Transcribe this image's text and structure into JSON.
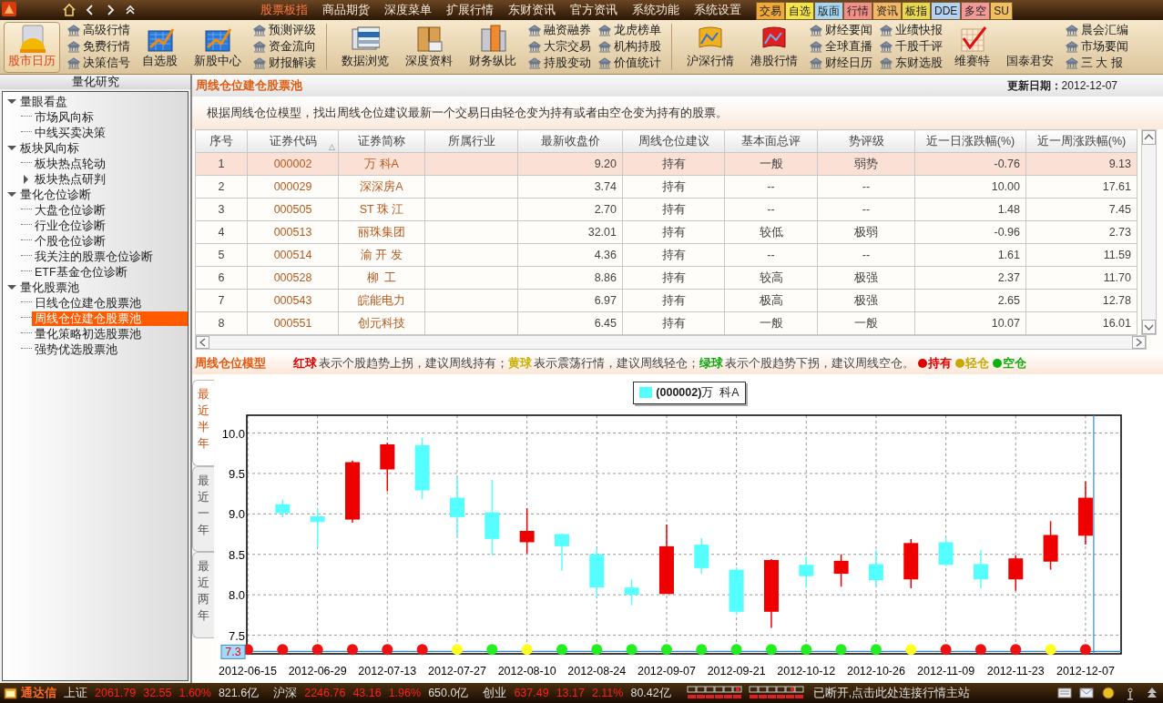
{
  "top_bar": {
    "menu": [
      {
        "label": "股票板指",
        "selected": true
      },
      {
        "label": "商品期货",
        "selected": false
      },
      {
        "label": "深度菜单",
        "selected": false
      },
      {
        "label": "扩展行情",
        "selected": false
      },
      {
        "label": "东财资讯",
        "selected": false
      },
      {
        "label": "官方资讯",
        "selected": false
      },
      {
        "label": "系统功能",
        "selected": false
      },
      {
        "label": "系统设置",
        "selected": false
      }
    ],
    "quick_tabs": [
      {
        "label": "交易",
        "color": "#f0a838"
      },
      {
        "label": "自选",
        "color": "#f2e44a"
      },
      {
        "label": "版面",
        "color": "#a6d6f2"
      },
      {
        "label": "行情",
        "color": "#f29088"
      },
      {
        "label": "资讯",
        "color": "#f2b866"
      },
      {
        "label": "板指",
        "color": "#e8d850"
      },
      {
        "label": "DDE",
        "color": "#b4d2f2"
      },
      {
        "label": "多空",
        "color": "#f29898"
      },
      {
        "label": "SU",
        "color": "#f0c060"
      }
    ]
  },
  "toolbar": [
    {
      "kind": "button",
      "label": "股市日历",
      "selected": true
    },
    {
      "kind": "links",
      "items": [
        "高级行情",
        "免费行情",
        "决策信号"
      ]
    },
    {
      "kind": "button",
      "label": "自选股",
      "selected": false
    },
    {
      "kind": "button",
      "label": "新股中心",
      "selected": false
    },
    {
      "kind": "links",
      "items": [
        "预测评级",
        "资金流向",
        "财报解读"
      ]
    },
    {
      "kind": "separator"
    },
    {
      "kind": "button",
      "label": "数据浏览",
      "selected": false
    },
    {
      "kind": "button",
      "label": "深度资料",
      "selected": false
    },
    {
      "kind": "button",
      "label": "财务纵比",
      "selected": false
    },
    {
      "kind": "links",
      "items": [
        "融资融券",
        "大宗交易",
        "持股变动"
      ]
    },
    {
      "kind": "links",
      "items": [
        "龙虎榜单",
        "机构持股",
        "价值统计"
      ]
    },
    {
      "kind": "separator"
    },
    {
      "kind": "button",
      "label": "沪深行情",
      "selected": false
    },
    {
      "kind": "button",
      "label": "港股行情",
      "selected": false
    },
    {
      "kind": "links",
      "items": [
        "财经要闻",
        "全球直播",
        "财经日历"
      ]
    },
    {
      "kind": "links",
      "items": [
        "业绩快报",
        "千股千评",
        "东财选股"
      ]
    },
    {
      "kind": "button",
      "label": "维赛特",
      "selected": false
    },
    {
      "kind": "button",
      "label": "国泰君安",
      "selected": false
    },
    {
      "kind": "links",
      "items": [
        "晨会汇编",
        "市场要闻",
        "三 大 报"
      ]
    }
  ],
  "sidebar": {
    "title": "量化研究",
    "tree": [
      {
        "label": "量眼看盘",
        "expanded": true,
        "selected": false,
        "children": [
          {
            "label": "市场风向标",
            "selected": false
          },
          {
            "label": "中线买卖决策",
            "selected": false
          }
        ]
      },
      {
        "label": "板块风向标",
        "expanded": true,
        "selected": false,
        "children": [
          {
            "label": "板块热点轮动",
            "selected": false
          },
          {
            "label": "板块热点研判",
            "expanded": false,
            "selected": false
          }
        ]
      },
      {
        "label": "量化仓位诊断",
        "expanded": true,
        "selected": false,
        "children": [
          {
            "label": "大盘仓位诊断",
            "selected": false
          },
          {
            "label": "行业仓位诊断",
            "selected": false
          },
          {
            "label": "个股仓位诊断",
            "selected": false
          },
          {
            "label": "我关注的股票仓位诊断",
            "selected": false
          },
          {
            "label": "ETF基金仓位诊断",
            "selected": false
          }
        ]
      },
      {
        "label": "量化股票池",
        "expanded": true,
        "selected": false,
        "children": [
          {
            "label": "日线仓位建仓股票池",
            "selected": false
          },
          {
            "label": "周线仓位建仓股票池",
            "selected": true
          },
          {
            "label": "量化策略初选股票池",
            "selected": false
          },
          {
            "label": "强势优选股票池",
            "selected": false
          }
        ]
      }
    ]
  },
  "page": {
    "title": "周线仓位建仓股票池",
    "update_label": "更新日期：",
    "update_date": "2012-12-07",
    "description": "根据周线仓位模型，找出周线仓位建议最新一个交易日由轻仓变为持有或者由空仓变为持有的股票。"
  },
  "table": {
    "columns": [
      {
        "label": "序号"
      },
      {
        "label": "证券代码",
        "sort_mark": "△"
      },
      {
        "label": "证券简称"
      },
      {
        "label": "所属行业"
      },
      {
        "label": "最新收盘价"
      },
      {
        "label": "周线仓位建议"
      },
      {
        "label": "基本面总评"
      },
      {
        "label": "势评级"
      },
      {
        "label": "近一日涨跌幅(%)"
      },
      {
        "label": "近一周涨跌幅(%)"
      }
    ],
    "rows": [
      {
        "selected": true,
        "cells": [
          "1",
          "000002",
          "万 科A",
          null,
          "9.20",
          "持有",
          "一般",
          "弱势",
          "-0.76",
          "9.13"
        ]
      },
      {
        "selected": false,
        "cells": [
          "2",
          "000029",
          "深深房A",
          null,
          "3.74",
          "持有",
          "--",
          "--",
          "10.00",
          "17.61"
        ]
      },
      {
        "selected": false,
        "cells": [
          "3",
          "000505",
          "ST 珠 江",
          null,
          "2.70",
          "持有",
          "--",
          "--",
          "1.48",
          "7.45"
        ]
      },
      {
        "selected": false,
        "cells": [
          "4",
          "000513",
          "丽珠集团",
          null,
          "32.01",
          "持有",
          "较低",
          "极弱",
          "-0.96",
          "2.73"
        ]
      },
      {
        "selected": false,
        "cells": [
          "5",
          "000514",
          "渝 开 发",
          null,
          "4.36",
          "持有",
          "--",
          "--",
          "1.61",
          "11.59"
        ]
      },
      {
        "selected": false,
        "cells": [
          "6",
          "000528",
          "柳  工",
          null,
          "8.86",
          "持有",
          "较高",
          "极强",
          "2.37",
          "11.70"
        ]
      },
      {
        "selected": false,
        "cells": [
          "7",
          "000543",
          "皖能电力",
          null,
          "6.97",
          "持有",
          "极高",
          "极强",
          "2.65",
          "12.78"
        ]
      },
      {
        "selected": false,
        "cells": [
          "8",
          "000551",
          "创元科技",
          null,
          "6.45",
          "持有",
          "一般",
          "一般",
          "10.07",
          "16.01"
        ]
      }
    ]
  },
  "model_legend": {
    "title": "周线仓位模型",
    "notes": [
      {
        "ball": "红球",
        "text": "表示个股趋势上拐，建议周线持有；",
        "color": "#dd0000"
      },
      {
        "ball": "黄球",
        "text": "表示震荡行情，建议周线轻仓；",
        "color": "#c8b000"
      },
      {
        "ball": "绿球",
        "text": "表示个股趋势下拐，建议周线空仓。",
        "color": "#10a810"
      }
    ],
    "keys": [
      {
        "label": "持有",
        "color": "#dd0000"
      },
      {
        "label": "轻仓",
        "color": "#c8a800"
      },
      {
        "label": "空仓",
        "color": "#10b010"
      }
    ]
  },
  "range_tabs": [
    {
      "label": "最近半年",
      "selected": true
    },
    {
      "label": "最近一年",
      "selected": false
    },
    {
      "label": "最近两年",
      "selected": false
    }
  ],
  "chart": {
    "legend": "**(000002)**万  科A",
    "readout": "7.3",
    "chart_data": {
      "type": "candlestick",
      "grid": true,
      "ref_lines": [
        {
          "axis": "y",
          "value": 7.3
        },
        {
          "axis": "x",
          "value": "2012-12-07"
        }
      ],
      "categories": [
        "2012-06-15",
        null,
        "2012-06-29",
        null,
        "2012-07-13",
        null,
        "2012-07-27",
        null,
        "2012-08-10",
        null,
        "2012-08-24",
        null,
        "2012-09-07",
        null,
        "2012-09-21",
        null,
        "2012-10-12",
        null,
        "2012-10-26",
        null,
        "2012-11-09",
        null,
        "2012-11-23",
        null,
        "2012-12-07"
      ],
      "ohlc": [
        null,
        [
          9.12,
          9.18,
          8.96,
          9.01
        ],
        [
          8.97,
          9.06,
          8.59,
          8.9
        ],
        [
          8.93,
          9.66,
          8.89,
          9.64
        ],
        [
          9.55,
          9.88,
          9.28,
          9.86
        ],
        [
          9.85,
          9.94,
          9.18,
          9.29
        ],
        [
          9.2,
          9.46,
          8.72,
          8.96
        ],
        [
          9.02,
          9.42,
          8.49,
          8.69
        ],
        [
          8.65,
          9.07,
          8.51,
          8.79
        ],
        [
          8.75,
          8.76,
          8.3,
          8.6
        ],
        [
          8.5,
          8.57,
          7.97,
          8.09
        ],
        [
          8.09,
          8.19,
          7.87,
          8.0
        ],
        [
          8.01,
          8.87,
          8.01,
          8.6
        ],
        [
          8.62,
          8.7,
          8.26,
          8.33
        ],
        [
          8.31,
          8.34,
          7.75,
          7.79
        ],
        [
          7.79,
          8.44,
          7.59,
          8.43
        ],
        [
          8.37,
          8.47,
          8.09,
          8.23
        ],
        [
          8.26,
          8.5,
          8.1,
          8.42
        ],
        [
          8.38,
          8.55,
          8.1,
          8.18
        ],
        [
          8.19,
          8.69,
          8.08,
          8.64
        ],
        [
          8.65,
          8.71,
          8.35,
          8.37
        ],
        [
          8.38,
          8.55,
          8.08,
          8.19
        ],
        [
          8.19,
          8.49,
          8.05,
          8.45
        ],
        [
          8.41,
          8.91,
          8.31,
          8.74
        ],
        [
          8.73,
          9.4,
          8.62,
          9.2
        ]
      ],
      "ylim": [
        7.27,
        10.22
      ],
      "yticks": [
        {
          "value": 7.5,
          "label": "7.5"
        },
        {
          "value": 8,
          "label": "8.0"
        },
        {
          "value": 8.5,
          "label": "8.5"
        },
        {
          "value": 9,
          "label": "9.0"
        },
        {
          "value": 9.5,
          "label": "9.5"
        },
        {
          "value": 10,
          "label": "10.0"
        }
      ]
    },
    "signals": [
      {
        "color": "#ee1111"
      },
      {
        "color": "#ee1111"
      },
      {
        "color": "#ee1111"
      },
      {
        "color": "#ee1111"
      },
      {
        "color": "#ee1111"
      },
      {
        "color": "#ee1111"
      },
      {
        "color": "#ffff22"
      },
      {
        "color": "#22ee22"
      },
      {
        "color": "#ffff22"
      },
      {
        "color": "#22ee22"
      },
      {
        "color": "#22ee22"
      },
      {
        "color": "#22ee22"
      },
      {
        "color": "#22ee22"
      },
      {
        "color": "#22ee22"
      },
      {
        "color": "#22ee22"
      },
      {
        "color": "#22ee22"
      },
      {
        "color": "#22ee22"
      },
      {
        "color": "#22ee22"
      },
      {
        "color": "#22ee22"
      },
      {
        "color": "#ffff22"
      },
      {
        "color": "#ee1111"
      },
      {
        "color": "#ee1111"
      },
      {
        "color": "#ee1111"
      },
      {
        "color": "#ffff22"
      },
      {
        "color": "#ee1111"
      }
    ]
  },
  "status_bar": {
    "app": "通达信",
    "indices": [
      {
        "name": "上证",
        "value": "2061.79",
        "change": "32.55",
        "percent": "1.60%",
        "amount": "821.6亿"
      },
      {
        "name": "沪深",
        "value": "2246.76",
        "change": "43.16",
        "percent": "1.96%",
        "amount": "650.0亿"
      },
      {
        "name": "创业",
        "value": "637.49",
        "change": "13.17",
        "percent": "2.11%",
        "amount": "80.42亿"
      }
    ],
    "message": "已断开,点击此处连接行情主站"
  }
}
